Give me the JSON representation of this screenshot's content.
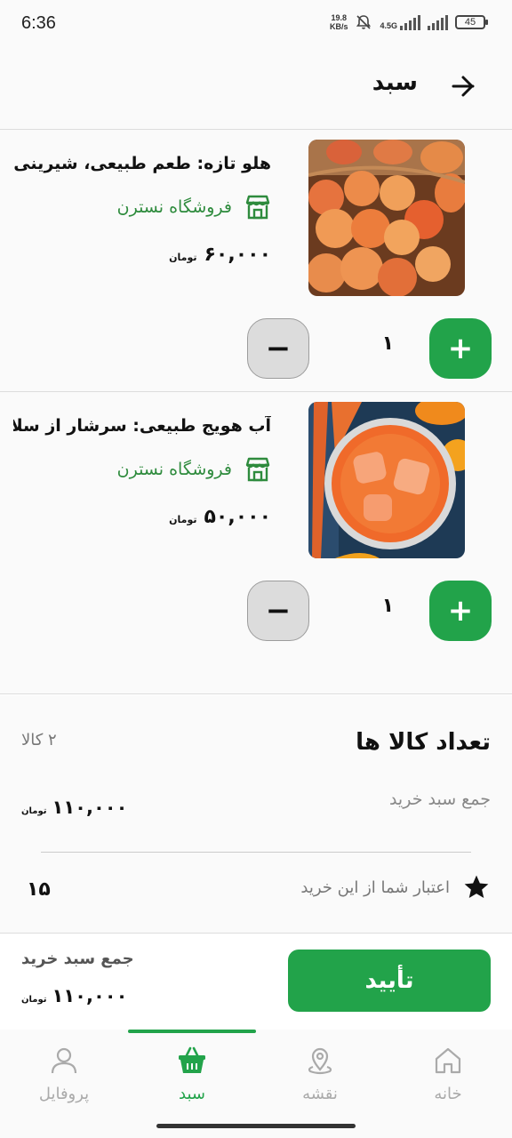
{
  "status_bar": {
    "time": "6:36",
    "net_speed": "19.8",
    "net_unit": "KB/s",
    "network": "4.5G",
    "battery": "45"
  },
  "header": {
    "title": "سبد"
  },
  "items": [
    {
      "name": "هلو تازه: طعم طبیعی، شیرینی ...",
      "store": "فروشگاه نسترن",
      "price": "۶۰,۰۰۰",
      "currency": "تومان",
      "quantity": "۱",
      "image": "peaches-photo"
    },
    {
      "name": "آب هویج طبیعی: سرشار از سلام...",
      "store": "فروشگاه نسترن",
      "price": "۵۰,۰۰۰",
      "currency": "تومان",
      "quantity": "۱",
      "image": "carrot-juice-photo"
    }
  ],
  "summary": {
    "count_label": "تعداد کالا ها",
    "count_value": "۲ کالا",
    "total_label": "جمع سبد خرید",
    "total_value": "۱۱۰,۰۰۰",
    "currency": "تومان",
    "credit_label": "اعتبار شما از این خرید",
    "credit_value": "۱۵"
  },
  "checkout": {
    "sum_label": "جمع سبد خرید",
    "sum_value": "۱۱۰,۰۰۰",
    "currency": "تومان",
    "confirm_label": "تأیید"
  },
  "nav": {
    "profile": "پروفایل",
    "cart": "سبد",
    "map": "نقشه",
    "home": "خانه",
    "active": "cart"
  },
  "colors": {
    "accent": "#22a34a",
    "store_text": "#2e8b3d",
    "background": "#fafafa"
  }
}
